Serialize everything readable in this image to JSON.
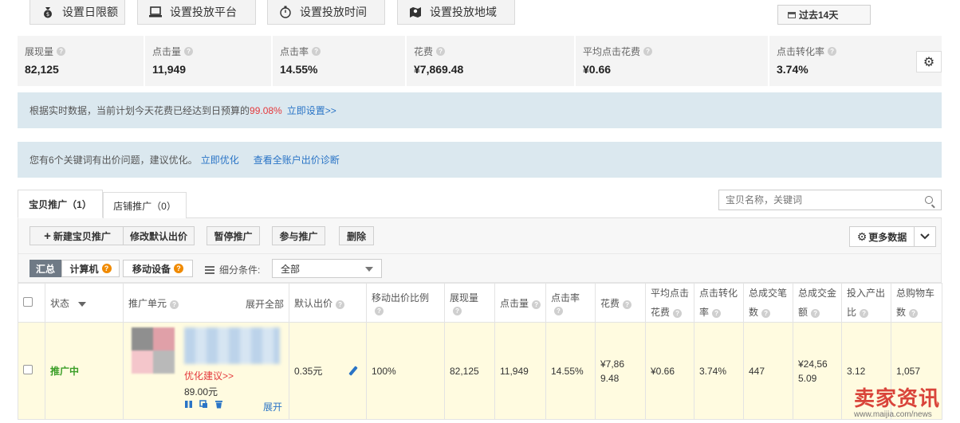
{
  "toolbar_top": {
    "daily_limit": "设置日限额",
    "platform": "设置投放平台",
    "time": "设置投放时间",
    "region": "设置投放地域",
    "date_range": "过去14天"
  },
  "stats": [
    {
      "label": "展现量",
      "value": "82,125"
    },
    {
      "label": "点击量",
      "value": "11,949"
    },
    {
      "label": "点击率",
      "value": "14.55%"
    },
    {
      "label": "花费",
      "value": "¥7,869.48"
    },
    {
      "label": "平均点击花费",
      "value": "¥0.66"
    },
    {
      "label": "点击转化率",
      "value": "3.74%"
    }
  ],
  "notice_budget": {
    "text": "根据实时数据，当前计划今天花费已经达到日预算的",
    "percent": "99.08%",
    "link": "立即设置>>"
  },
  "notice_keywords": {
    "text": "您有6个关键词有出价问题，建议优化。",
    "link1": "立即优化",
    "link2": "查看全账户出价诊断"
  },
  "tabs": [
    {
      "label": "宝贝推广（1）"
    },
    {
      "label": "店铺推广（0）"
    }
  ],
  "search": {
    "placeholder": "宝贝名称，关键词"
  },
  "actions": {
    "new": "新建宝贝推广",
    "modify_bid": "修改默认出价",
    "pause": "暂停推广",
    "join": "参与推广",
    "delete": "删除",
    "more_data": "更多数据"
  },
  "filter": {
    "summary": "汇总",
    "computer": "计算机",
    "mobile": "移动设备",
    "condition_label": "细分条件:",
    "condition_value": "全部"
  },
  "table": {
    "headers": {
      "status": "状态",
      "unit": "推广单元",
      "expand_all": "展开全部",
      "default_bid": "默认出价",
      "mobile_ratio": "移动出价比例",
      "impressions": "展现量",
      "clicks": "点击量",
      "ctr": "点击率",
      "cost": "花费",
      "avg_cpc_1": "平均点击",
      "avg_cpc_2": "花费",
      "cvr_1": "点击转化",
      "cvr_2": "率",
      "deals_1": "总成交笔",
      "deals_2": "数",
      "amount_1": "总成交金",
      "amount_2": "额",
      "roi_1": "投入产出",
      "roi_2": "比",
      "cart_1": "总购物车",
      "cart_2": "数"
    },
    "row": {
      "status": "推广中",
      "optimize": "优化建议>>",
      "price": "89.00元",
      "expand": "展开",
      "default_bid": "0.35元",
      "mobile_ratio": "100%",
      "impressions": "82,125",
      "clicks": "11,949",
      "ctr": "14.55%",
      "cost_1": "¥7,86",
      "cost_2": "9.48",
      "avg_cpc": "¥0.66",
      "cvr": "3.74%",
      "deals": "447",
      "amount_1": "¥24,56",
      "amount_2": "5.09",
      "roi": "3.12",
      "cart": "1,057"
    }
  },
  "watermark": {
    "brand": "卖家资讯",
    "url": "www.maijia.com/news"
  }
}
